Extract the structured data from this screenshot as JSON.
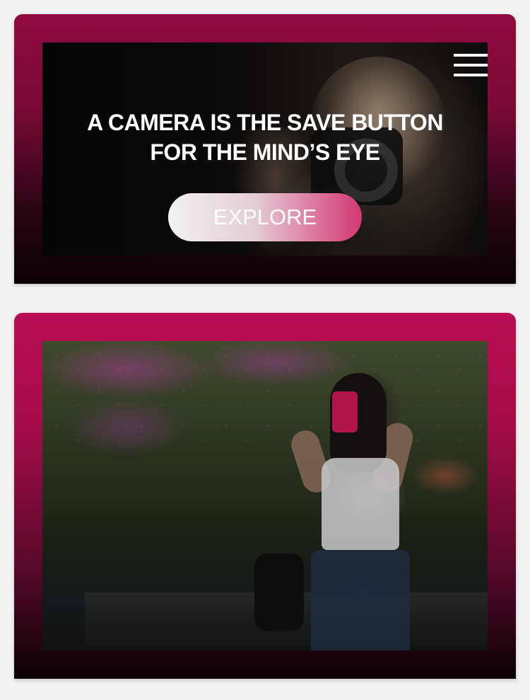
{
  "hero": {
    "headline_line1": "A CAMERA IS THE SAVE BUTTON",
    "headline_line2": "FOR THE MIND’S EYE",
    "cta_label": "EXPLORE",
    "menu_icon": "hamburger-menu-icon"
  },
  "colors": {
    "card_top": "#8f0a3e",
    "card_bottom": "#0b0206",
    "card2_top": "#b80d52",
    "button_border_accent": "#e03a7a",
    "page_background": "#f2f2f2"
  }
}
